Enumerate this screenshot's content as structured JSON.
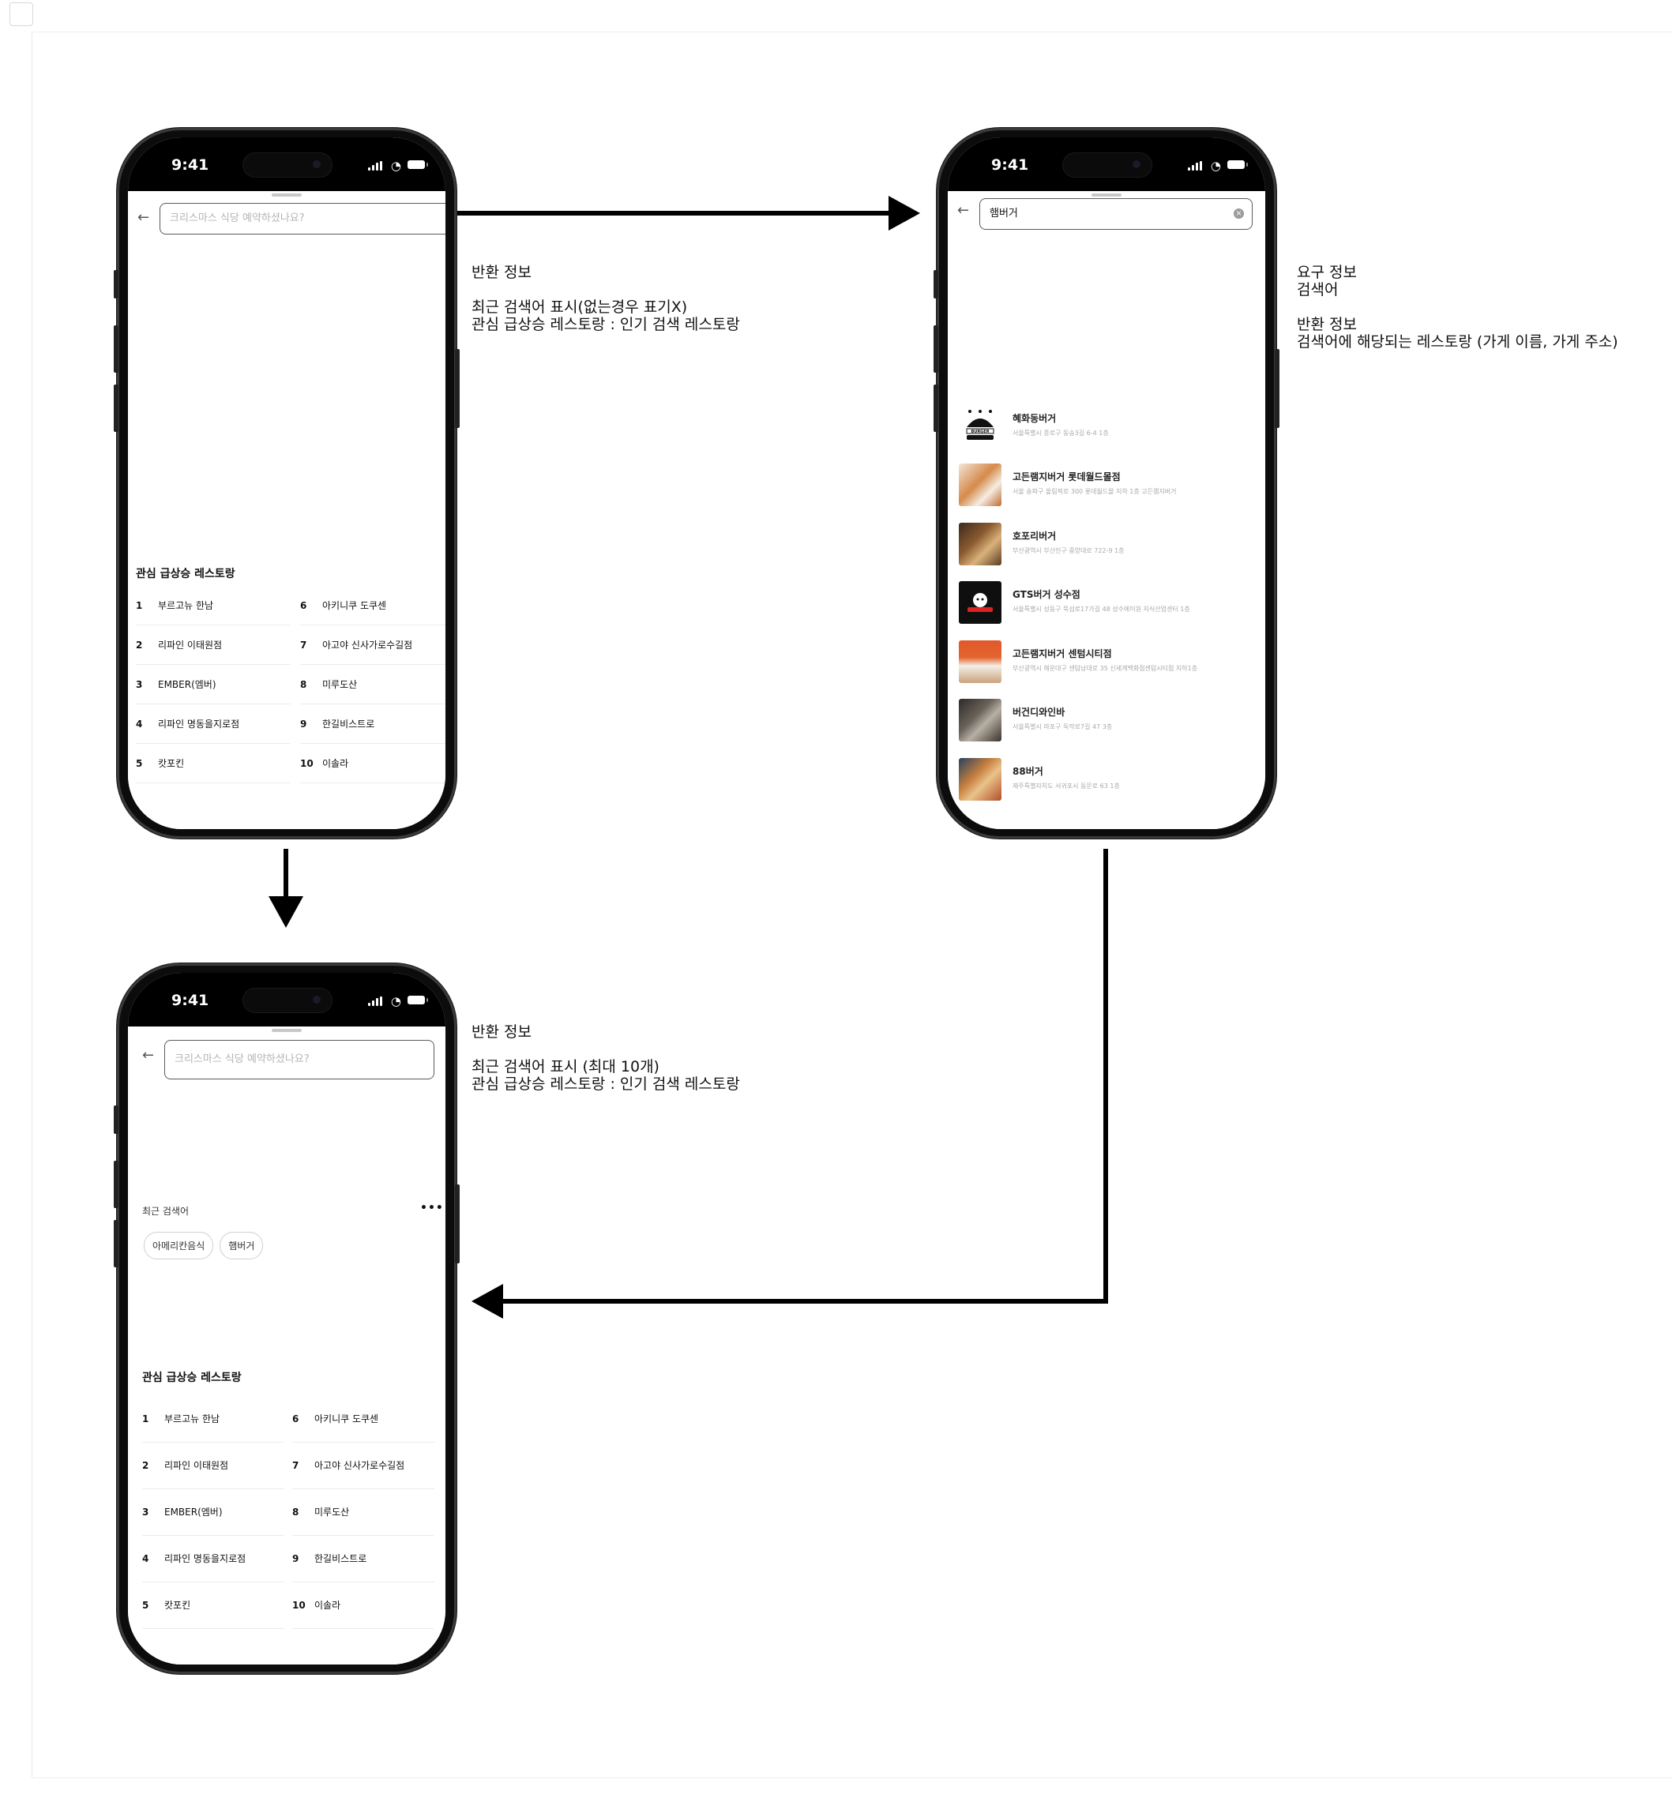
{
  "status_time": "9:41",
  "screen1": {
    "search_placeholder": "크리스마스 식당 예약하셨나요?",
    "trending_title": "관심 급상승 레스토랑",
    "ranking": [
      {
        "rank": "1",
        "name": "부르고뉴 한남"
      },
      {
        "rank": "2",
        "name": "리파인 이태원점"
      },
      {
        "rank": "3",
        "name": "EMBER(엠버)"
      },
      {
        "rank": "4",
        "name": "리파인 명동을지로점"
      },
      {
        "rank": "5",
        "name": "캇포킨"
      },
      {
        "rank": "6",
        "name": "아키니쿠 도쿠센"
      },
      {
        "rank": "7",
        "name": "아고야 신사가로수길점"
      },
      {
        "rank": "8",
        "name": "미루도산"
      },
      {
        "rank": "9",
        "name": "한길비스트로"
      },
      {
        "rank": "10",
        "name": "이솔라"
      }
    ]
  },
  "screen2": {
    "search_value": "햄버거",
    "results": [
      {
        "name": "혜화동버거",
        "address": "서울특별시 종로구 동숭3길 6-4 1층",
        "thumb": "burger-logo"
      },
      {
        "name": "고든램지버거 롯데월드몰점",
        "address": "서울 송파구 올림픽로 300 롯데월드몰 지하 1층 고든램지버거",
        "thumb": "food-photo"
      },
      {
        "name": "호포리버거",
        "address": "부산광역시 부산진구 중앙대로 722-9 1층",
        "thumb": "food-photo"
      },
      {
        "name": "GTS버거 성수점",
        "address": "서울특별시 성동구 뚝섬로17가길 48 성수에이원 지식산업센터 1층",
        "thumb": "gts-logo"
      },
      {
        "name": "고든램지버거 센텀시티점",
        "address": "부산광역시 해운대구 센텀남대로 35 신세계백화점센텀시티점 지하1층",
        "thumb": "food-photo"
      },
      {
        "name": "버건디와인바",
        "address": "서울특별시 마포구 독막로7길 47 3층",
        "thumb": "food-photo"
      },
      {
        "name": "88버거",
        "address": "제주특별자치도 서귀포시 동문로 63 1층",
        "thumb": "food-photo"
      }
    ]
  },
  "screen3": {
    "search_placeholder": "크리스마스 식당 예약하셨나요?",
    "recent_title": "최근 검색어",
    "more_label": "•••",
    "recent_chips": [
      "아메리칸음식",
      "햄버거"
    ],
    "trending_title": "관심 급상승 레스토랑",
    "ranking": [
      {
        "rank": "1",
        "name": "부르고뉴 한남"
      },
      {
        "rank": "2",
        "name": "리파인 이태원점"
      },
      {
        "rank": "3",
        "name": "EMBER(엠버)"
      },
      {
        "rank": "4",
        "name": "리파인 명동을지로점"
      },
      {
        "rank": "5",
        "name": "캇포킨"
      },
      {
        "rank": "6",
        "name": "아키니쿠 도쿠센"
      },
      {
        "rank": "7",
        "name": "아고야 신사가로수길점"
      },
      {
        "rank": "8",
        "name": "미루도산"
      },
      {
        "rank": "9",
        "name": "한길비스트로"
      },
      {
        "rank": "10",
        "name": "이솔라"
      }
    ]
  },
  "notes": {
    "screen1": "반환 정보\n\n최근 검색어 표시(없는경우 표기X)\n관심 급상승 레스토랑 : 인기 검색 레스토랑",
    "screen2": "요구 정보\n검색어\n\n반환 정보\n검색어에 해당되는 레스토랑 (가게 이름, 가게 주소)",
    "screen3": "반환 정보\n\n최근 검색어 표시 (최대 10개)\n관심 급상승 레스토랑 : 인기 검색 레스토랑"
  }
}
